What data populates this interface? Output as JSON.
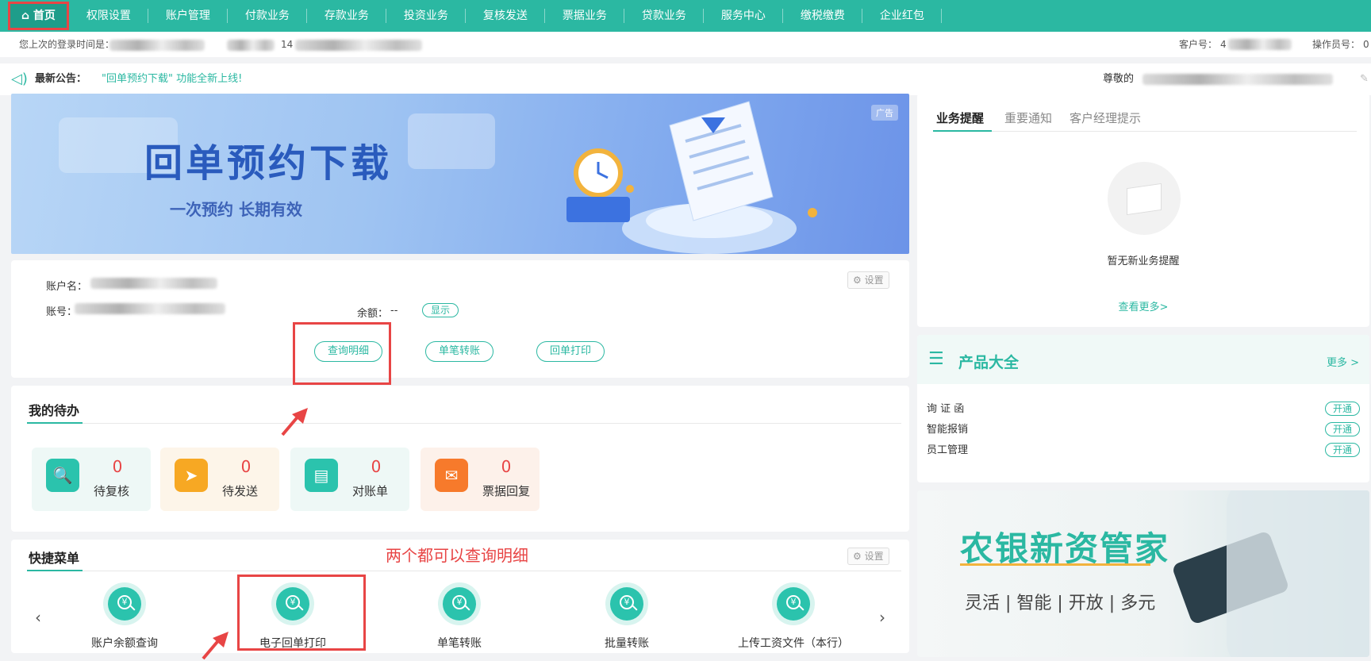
{
  "nav": {
    "items": [
      {
        "label": "首页",
        "icon": "home-icon"
      },
      {
        "label": "权限设置"
      },
      {
        "label": "账户管理"
      },
      {
        "label": "付款业务"
      },
      {
        "label": "存款业务"
      },
      {
        "label": "投资业务"
      },
      {
        "label": "复核发送"
      },
      {
        "label": "票据业务"
      },
      {
        "label": "贷款业务"
      },
      {
        "label": "服务中心"
      },
      {
        "label": "缴税缴费"
      },
      {
        "label": "企业红包"
      }
    ]
  },
  "infobar": {
    "last_login_label": "您上次的登录时间是：",
    "last_login_time_fragment": "14",
    "customer_no_label": "客户号：",
    "customer_no_fragment": "4",
    "operator_no_label": "操作员号：",
    "operator_no_fragment": "0"
  },
  "notice": {
    "label": "最新公告：",
    "text": "\"回单预约下载\" 功能全新上线!",
    "greeting": "尊敬的"
  },
  "banner": {
    "title": "回单预约下载",
    "subtitle": "一次预约  长期有效",
    "ad_badge": "广告"
  },
  "account": {
    "name_label": "账户名：",
    "number_label": "账号：",
    "balance_label": "余额：",
    "balance_value": "--",
    "show_button": "显示",
    "settings_button": "设置",
    "actions": [
      "查询明细",
      "单笔转账",
      "回单打印"
    ]
  },
  "todo": {
    "title": "我的待办",
    "items": [
      {
        "label": "待复核",
        "count": "0",
        "icon": "review-search-icon",
        "color": "#2bc3ad",
        "bg": "#eef8f6"
      },
      {
        "label": "待发送",
        "count": "0",
        "icon": "send-plane-icon",
        "color": "#f7a823",
        "bg": "#fdf5e9"
      },
      {
        "label": "对账单",
        "count": "0",
        "icon": "statement-icon",
        "color": "#2bc3ad",
        "bg": "#eef8f6"
      },
      {
        "label": "票据回复",
        "count": "0",
        "icon": "mail-reply-icon",
        "color": "#f77a2b",
        "bg": "#fdf1ea"
      }
    ]
  },
  "quick_menu": {
    "title": "快捷菜单",
    "settings_button": "设置",
    "prev": "‹",
    "next": "›",
    "items": [
      {
        "label": "账户余额查询",
        "icon": "yuan-search-icon"
      },
      {
        "label": "电子回单打印",
        "icon": "yuan-search-icon"
      },
      {
        "label": "单笔转账",
        "icon": "yuan-search-icon"
      },
      {
        "label": "批量转账",
        "icon": "yuan-search-icon"
      },
      {
        "label": "上传工资文件（本行）",
        "icon": "yuan-search-icon"
      }
    ]
  },
  "annotation": {
    "text": "两个都可以查询明细",
    "color": "#e84545"
  },
  "reminder": {
    "tabs": [
      "业务提醒",
      "重要通知",
      "客户经理提示"
    ],
    "empty_text": "暂无新业务提醒",
    "more_link": "查看更多>"
  },
  "products": {
    "title": "产品大全",
    "more": "更多 >",
    "items": [
      {
        "name": "询 证 函",
        "action": "开通"
      },
      {
        "name": "智能报销",
        "action": "开通"
      },
      {
        "name": "员工管理",
        "action": "开通"
      }
    ]
  },
  "promo": {
    "title": "农银新资管家",
    "subtitle": "灵活 | 智能 | 开放 | 多元"
  },
  "colors": {
    "brand": "#2bb8a2",
    "highlight": "#e84545"
  }
}
